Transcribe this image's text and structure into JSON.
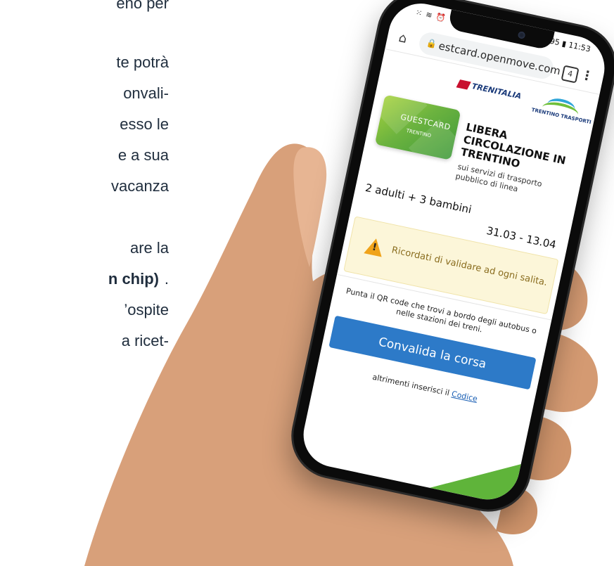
{
  "article": {
    "lines": [
      {
        "text": "eno per",
        "bold": false
      },
      {
        "text": "te potrà",
        "bold": false
      },
      {
        "text": "onvali-",
        "bold": false
      },
      {
        "text": "esso le",
        "bold": false
      },
      {
        "text": "e a sua",
        "bold": false
      },
      {
        "text": "vacanza",
        "bold": false
      },
      {
        "text": "are la",
        "bold": false
      },
      {
        "text": "n chip)",
        "bold": true
      },
      {
        "text": "’ospite",
        "bold": false
      },
      {
        "text": "a ricet-",
        "bold": false
      }
    ],
    "trailing_period": "."
  },
  "statusbar": {
    "time": "11:53",
    "battery": "95",
    "left_icons": "⁙ ≋ ⏰"
  },
  "browser": {
    "url": "estcard.openmove.com",
    "tab_count": "4",
    "home_icon": "home-icon",
    "menu_icon": "menu-icon"
  },
  "brand": {
    "trenitalia": "TRENITALIA",
    "trentino_trasporti": "TRENTINO TRASPORTI"
  },
  "card": {
    "label": "GUESTCARD",
    "sublabel": "TRENTINO"
  },
  "ticket": {
    "title": "LIBERA CIRCOLAZIONE IN TRENTINO",
    "subtitle": "sui servizi di trasporto pubblico di linea",
    "people": "2 adulti + 3 bambini",
    "dates": "31.03 - 13.04"
  },
  "warning": {
    "text": "Ricordati di validare ad ogni salita."
  },
  "validate": {
    "hint": "Punta il QR code che trovi a bordo degli autobus o nelle stazioni dei treni.",
    "button_label": "Convalida la corsa",
    "alt_prefix": "altrimenti inserisci il",
    "alt_link": "Codice"
  },
  "colors": {
    "button": "#2d7ac8",
    "warning_bg": "#fcf6d9",
    "card_green": "#6cb33f"
  }
}
